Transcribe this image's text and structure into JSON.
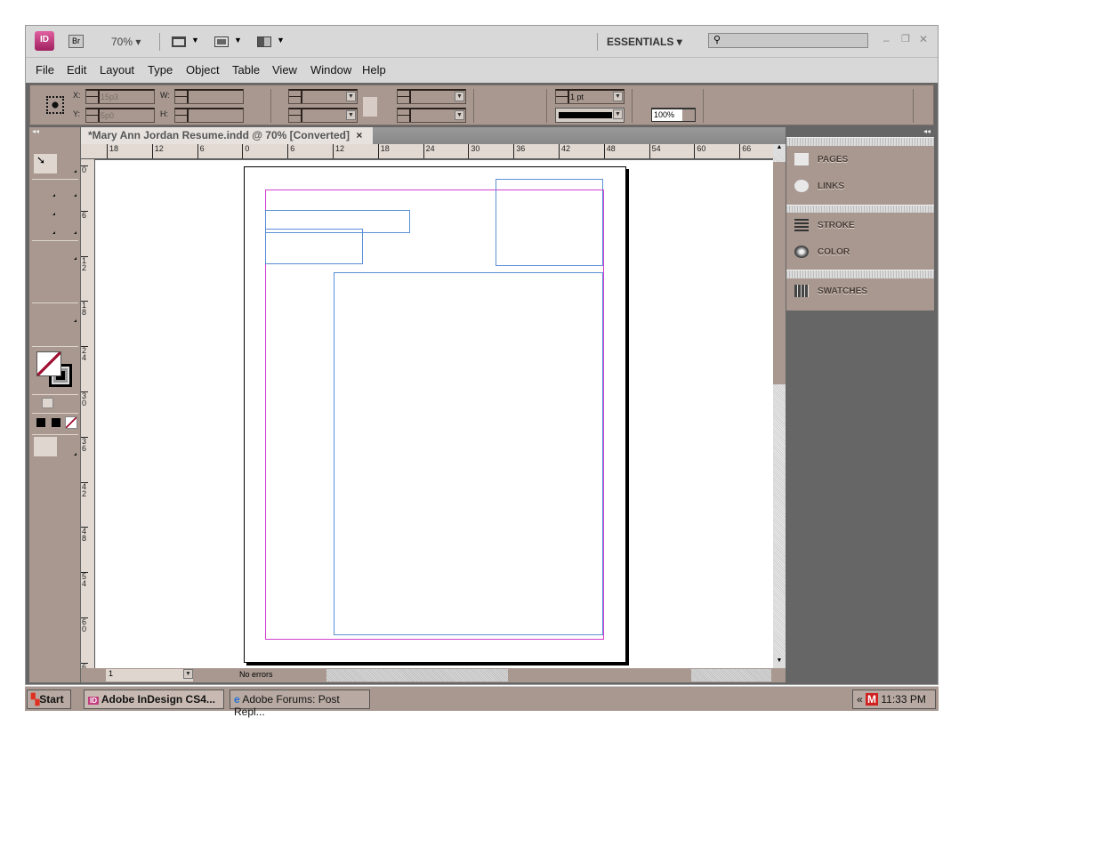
{
  "app": {
    "logo": "ID",
    "bridge": "Br",
    "zoom": "70%",
    "workspace": "ESSENTIALS",
    "search_placeholder": ""
  },
  "menu": [
    "File",
    "Edit",
    "Layout",
    "Type",
    "Object",
    "Table",
    "View",
    "Window",
    "Help"
  ],
  "control": {
    "x_label": "X:",
    "x_value": "15p3",
    "y_label": "Y:",
    "y_value": "5p0",
    "w_label": "W:",
    "h_label": "H:",
    "stroke_weight": "1 pt",
    "opacity": "100%"
  },
  "document": {
    "tab_title": "*Mary Ann Jordan Resume.indd @ 70% [Converted]",
    "close": "×"
  },
  "ruler": {
    "top": [
      "18",
      "12",
      "6",
      "0",
      "6",
      "12",
      "18",
      "24",
      "30",
      "36",
      "42",
      "48",
      "54",
      "60",
      "66"
    ],
    "left": [
      "0",
      "6",
      "12",
      "18",
      "24",
      "30",
      "36",
      "42",
      "48",
      "54",
      "60",
      "6"
    ]
  },
  "panels": [
    {
      "label": "PAGES",
      "icon": "pages-icon"
    },
    {
      "label": "LINKS",
      "icon": "links-icon"
    },
    {
      "label": "STROKE",
      "icon": "stroke-icon"
    },
    {
      "label": "COLOR",
      "icon": "color-icon"
    },
    {
      "label": "SWATCHES",
      "icon": "swatches-icon"
    }
  ],
  "status": {
    "page": "1",
    "preflight": "No errors"
  },
  "taskbar": {
    "start": "Start",
    "items": [
      "Adobe InDesign CS4...",
      "Adobe Forums: Post Repl..."
    ],
    "clock": "11:33 PM",
    "tray": "«"
  },
  "colors": {
    "margin": "#d040d0",
    "frame": "#5b8fd6",
    "panel": "#a89890"
  }
}
